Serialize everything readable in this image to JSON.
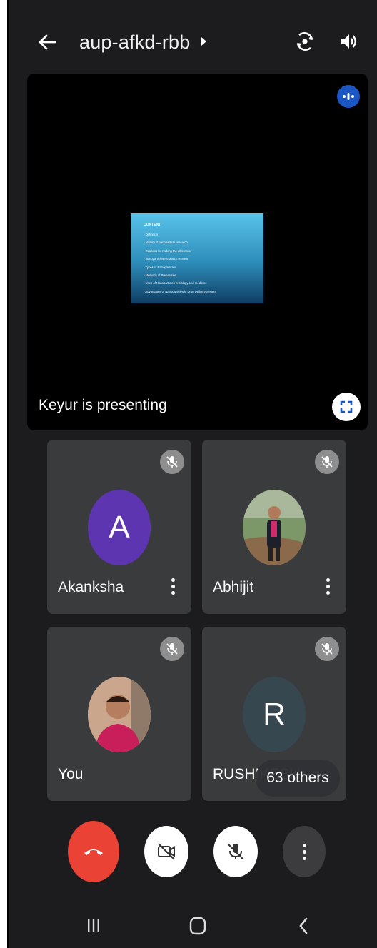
{
  "header": {
    "meeting_code": "aup-afkd-rbb",
    "icons": [
      "back-arrow-icon",
      "chevron-right-icon",
      "switch-camera-icon",
      "speaker-icon"
    ]
  },
  "presentation": {
    "status": "Keyur is presenting",
    "slide": {
      "title": "CONTENT",
      "items": [
        "• Definition",
        "• History of nanoparticle research",
        "• Reasons for making the difference",
        "• Nanoparticles Research Review",
        "• Types of Nanoparticles",
        "• Methods of Preparation",
        "• Uses of Nanoparticles in biology and medicine",
        "• Advantages of Nanoparticles in Drug Delivery System"
      ]
    }
  },
  "participants": [
    {
      "name": "Akanksha",
      "avatar_letter": "A",
      "avatar_color": "#5e35b1",
      "muted": true
    },
    {
      "name": "Abhijit",
      "avatar_letter": "",
      "avatar_color": "#4c6b44",
      "muted": true
    },
    {
      "name": "You",
      "avatar_letter": "",
      "avatar_color": "#c2185b",
      "muted": true
    },
    {
      "name": "RUSHIKESH",
      "avatar_letter": "R",
      "avatar_color": "#37474f",
      "muted": true
    }
  ],
  "others_badge": "63 others",
  "controls": {
    "end_call_color": "#ea4335",
    "icons": [
      "end-call-icon",
      "camera-off-icon",
      "mic-off-icon",
      "more-options-icon"
    ]
  },
  "navbar": {
    "icons": [
      "recent-apps-icon",
      "home-icon",
      "back-nav-icon"
    ]
  }
}
